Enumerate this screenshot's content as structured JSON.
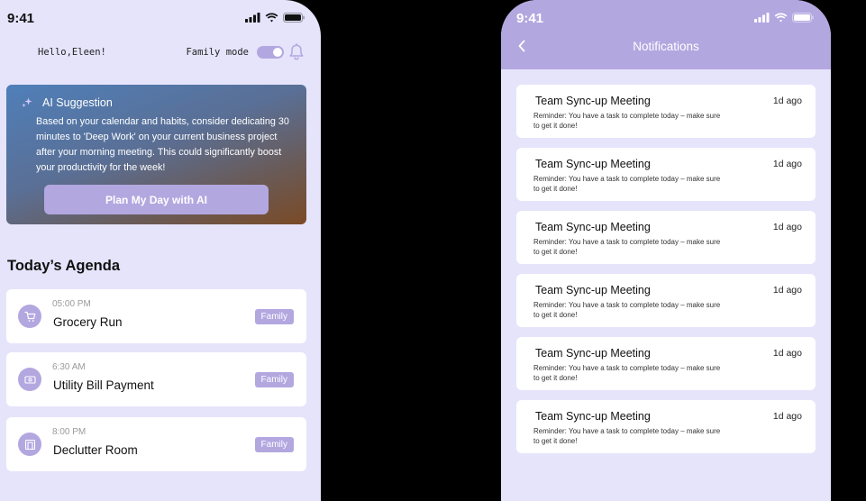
{
  "home": {
    "status_time": "9:41",
    "greeting": "Hello,Eleen!",
    "family_mode_label": "Family mode",
    "family_mode_on": true,
    "ai_card": {
      "icon": "sparkle-icon",
      "title": "AI Suggestion",
      "body": "Based on your calendar and habits, consider dedicating 30 minutes to 'Deep Work' on your current business project after your morning meeting. This could significantly boost your productivity for the week!",
      "button_label": "Plan My Day with AI"
    },
    "agenda_title": "Today’s Agenda",
    "agenda": [
      {
        "time": "05:00 PM",
        "title": "Grocery Run",
        "tag": "Family",
        "icon": "cart-icon"
      },
      {
        "time": "6:30 AM",
        "title": "Utility Bill Payment",
        "tag": "Family",
        "icon": "bill-icon"
      },
      {
        "time": "8:00 PM",
        "title": "Declutter Room",
        "tag": "Family",
        "icon": "room-icon"
      }
    ]
  },
  "notifications": {
    "status_time": "9:41",
    "title": "Notifications",
    "items": [
      {
        "title": "Team Sync-up Meeting",
        "age": "1d ago",
        "body": "Reminder: You have a task to complete today – make sure to get it done!"
      },
      {
        "title": "Team Sync-up Meeting",
        "age": "1d ago",
        "body": "Reminder: You have a task to complete today – make sure to get it done!"
      },
      {
        "title": "Team Sync-up Meeting",
        "age": "1d ago",
        "body": "Reminder: You have a task to complete today – make sure to get it done!"
      },
      {
        "title": "Team Sync-up Meeting",
        "age": "1d ago",
        "body": "Reminder: You have a task to complete today – make sure to get it done!"
      },
      {
        "title": "Team Sync-up Meeting",
        "age": "1d ago",
        "body": "Reminder: You have a task to complete today – make sure to get it done!"
      },
      {
        "title": "Team Sync-up Meeting",
        "age": "1d ago",
        "body": "Reminder: You have a task to complete today – make sure to get it done!"
      }
    ]
  },
  "colors": {
    "accent": "#b3a7e0",
    "background": "#e6e4fb",
    "card": "#ffffff"
  }
}
